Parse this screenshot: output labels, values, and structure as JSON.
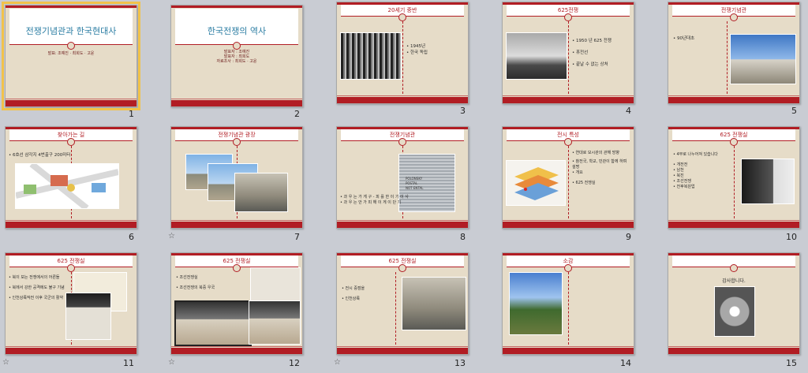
{
  "slides": [
    {
      "num": "1",
      "title": "전쟁기념관과 한국현대사",
      "subtitle_lines": [
        "발표: 조예진 · 최희도 · 고윤"
      ]
    },
    {
      "num": "2",
      "title": "한국전쟁의 역사",
      "subtitle_lines": [
        "발표자 : 조예진",
        "발표자 : 최희도",
        "자료조사 : 최희도 · 고윤"
      ]
    },
    {
      "num": "3",
      "title": "20세기 중반",
      "bullets": [
        "1945년",
        "한국 독립"
      ]
    },
    {
      "num": "4",
      "title": "625전쟁",
      "bullets": [
        "1950 년 625 전쟁",
        "휴전선",
        "끝날 수 없는 상처"
      ]
    },
    {
      "num": "5",
      "title": "전쟁기념관",
      "bullets": [
        "90년대초"
      ]
    },
    {
      "num": "6",
      "title": "찾아가는 길",
      "bullets": [
        "6호선 삼각지 4번출구 200미터"
      ]
    },
    {
      "num": "7",
      "title": "전쟁기념관 광장",
      "star": "☆"
    },
    {
      "num": "8",
      "title": "전쟁기념관",
      "bullets": [
        "과 우 는 가 게 구 - 피 를 한 이 기 이 사",
        "과 우 는 안 가 피 해 이 게 이 단 기"
      ],
      "doc_text": [
        "POLONSKY",
        "POSTAL",
        "NOT ENTAL"
      ]
    },
    {
      "num": "9",
      "title": "전시 특성",
      "bullets": [
        "연대로 모시관의 관해 방향",
        "참전국, 학교, 민관이 함께 하며 설명",
        "개요",
        "625 전쟁실"
      ]
    },
    {
      "num": "10",
      "title": "625 전쟁실",
      "bullets": [
        "4부로 나누어져 있습니다",
        "개전전",
        "남천",
        "북진",
        "조선전쟁",
        "전후복원업"
      ]
    },
    {
      "num": "11",
      "title": "625 전쟁실",
      "bullets": [
        "북이 보는 전쟁에서의 어른들",
        "북에서 강한 공격에도 불구 기념",
        "인천상륙작전 이후 국군의 활약"
      ],
      "star": "☆"
    },
    {
      "num": "12",
      "title": "625 전쟁실",
      "bullets": [
        "조선전쟁실",
        "조선전쟁의 북중 우국"
      ],
      "star": "☆"
    },
    {
      "num": "13",
      "title": "625 전쟁실",
      "bullets": [
        "전시 중점을",
        "인천상륙"
      ],
      "star": "☆"
    },
    {
      "num": "14",
      "title": "소감"
    },
    {
      "num": "15",
      "title": "",
      "body_text": "감사합니다."
    }
  ],
  "colors": {
    "accent": "#b11d24",
    "title_blue": "#2b7da3",
    "slide_bg": "#e6dcc8",
    "selection": "#f1c24a",
    "workspace": "#c9ccd3"
  },
  "selected_slide": "1"
}
